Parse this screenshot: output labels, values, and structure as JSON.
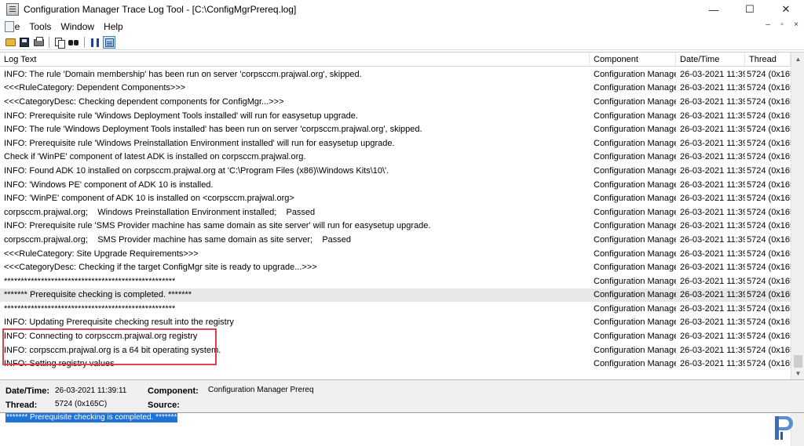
{
  "window": {
    "title": "Configuration Manager Trace Log Tool - [C:\\ConfigMgrPrereq.log]",
    "controls": [
      "—",
      "☐",
      "✕"
    ],
    "mdi_controls": [
      "–",
      "▫",
      "×"
    ]
  },
  "menu": [
    "File",
    "Tools",
    "Window",
    "Help"
  ],
  "toolbar": {
    "buttons": [
      "open-icon",
      "save-icon",
      "print-icon",
      "copy-icon",
      "find-icon",
      "pause-icon",
      "window-icon"
    ]
  },
  "grid": {
    "columns": {
      "log_text": "Log Text",
      "component": "Component",
      "datetime": "Date/Time",
      "thread": "Thread"
    },
    "rows": [
      {
        "text": "INFO: The rule 'Domain membership' has been run on server 'corpsccm.prajwal.org', skipped.",
        "component": "Configuration Manage",
        "datetime": "26-03-2021 11:39",
        "thread": "5724 (0x165"
      },
      {
        "text": "<<<RuleCategory: Dependent Components>>>",
        "component": "Configuration Manage",
        "datetime": "26-03-2021 11:39",
        "thread": "5724 (0x165"
      },
      {
        "text": "<<<CategoryDesc: Checking dependent components for ConfigMgr...>>>",
        "component": "Configuration Manage",
        "datetime": "26-03-2021 11:39",
        "thread": "5724 (0x165"
      },
      {
        "text": "INFO: Prerequisite rule 'Windows Deployment Tools installed' will run for easysetup upgrade.",
        "component": "Configuration Manage",
        "datetime": "26-03-2021 11:39",
        "thread": "5724 (0x165"
      },
      {
        "text": "INFO: The rule 'Windows Deployment Tools installed' has been run on server 'corpsccm.prajwal.org', skipped.",
        "component": "Configuration Manage",
        "datetime": "26-03-2021 11:39",
        "thread": "5724 (0x165"
      },
      {
        "text": "INFO: Prerequisite rule 'Windows Preinstallation Environment installed' will run for easysetup upgrade.",
        "component": "Configuration Manage",
        "datetime": "26-03-2021 11:39",
        "thread": "5724 (0x165"
      },
      {
        "text": "Check if 'WinPE' component of latest ADK is installed on corpsccm.prajwal.org.",
        "component": "Configuration Manage",
        "datetime": "26-03-2021 11:39",
        "thread": "5724 (0x165"
      },
      {
        "text": "INFO: Found ADK 10 installed on corpsccm.prajwal.org at 'C:\\Program Files (x86)\\Windows Kits\\10\\'.",
        "component": "Configuration Manage",
        "datetime": "26-03-2021 11:39",
        "thread": "5724 (0x165"
      },
      {
        "text": "INFO: 'Windows PE' component of ADK 10 is installed.",
        "component": "Configuration Manage",
        "datetime": "26-03-2021 11:39",
        "thread": "5724 (0x165"
      },
      {
        "text": "INFO: 'WinPE' component of ADK 10 is installed on <corpsccm.prajwal.org>",
        "component": "Configuration Manage",
        "datetime": "26-03-2021 11:39",
        "thread": "5724 (0x165"
      },
      {
        "text": "corpsccm.prajwal.org;    Windows Preinstallation Environment installed;    Passed",
        "component": "Configuration Manage",
        "datetime": "26-03-2021 11:39",
        "thread": "5724 (0x165"
      },
      {
        "text": "INFO: Prerequisite rule 'SMS Provider machine has same domain as site server' will run for easysetup upgrade.",
        "component": "Configuration Manage",
        "datetime": "26-03-2021 11:39",
        "thread": "5724 (0x165"
      },
      {
        "text": "corpsccm.prajwal.org;    SMS Provider machine has same domain as site server;    Passed",
        "component": "Configuration Manage",
        "datetime": "26-03-2021 11:39",
        "thread": "5724 (0x165"
      },
      {
        "text": "<<<RuleCategory: Site Upgrade Requirements>>>",
        "component": "Configuration Manage",
        "datetime": "26-03-2021 11:39",
        "thread": "5724 (0x165"
      },
      {
        "text": "<<<CategoryDesc: Checking if the target ConfigMgr site is ready to upgrade...>>>",
        "component": "Configuration Manage",
        "datetime": "26-03-2021 11:39",
        "thread": "5724 (0x165"
      },
      {
        "text": "***************************************************",
        "component": "Configuration Manage",
        "datetime": "26-03-2021 11:39",
        "thread": "5724 (0x165"
      },
      {
        "text": "******* Prerequisite checking is completed. *******",
        "component": "Configuration Manage",
        "datetime": "26-03-2021 11:39",
        "thread": "5724 (0x165",
        "selected": true
      },
      {
        "text": "***************************************************",
        "component": "Configuration Manage",
        "datetime": "26-03-2021 11:39",
        "thread": "5724 (0x165"
      },
      {
        "text": "INFO: Updating Prerequisite checking result into the registry",
        "component": "Configuration Manage",
        "datetime": "26-03-2021 11:39",
        "thread": "5724 (0x165"
      },
      {
        "text": "INFO: Connecting to corpsccm.prajwal.org registry",
        "component": "Configuration Manage",
        "datetime": "26-03-2021 11:39",
        "thread": "5724 (0x165"
      },
      {
        "text": "INFO: corpsccm.prajwal.org is a 64 bit operating system.",
        "component": "Configuration Manage",
        "datetime": "26-03-2021 11:39",
        "thread": "5724 (0x165"
      },
      {
        "text": "INFO: Setting registry values",
        "component": "Configuration Manage",
        "datetime": "26-03-2021 11:39",
        "thread": "5724 (0x165"
      }
    ]
  },
  "details": {
    "datetime_label": "Date/Time:",
    "datetime_value": "26-03-2021 11:39:11",
    "component_label": "Component:",
    "component_value": "Configuration Manager Prereq",
    "thread_label": "Thread:",
    "thread_value": "5724 (0x165C)",
    "source_label": "Source:",
    "source_value": ""
  },
  "message": {
    "selected_text": "******* Prerequisite checking is completed. *******"
  },
  "colors": {
    "highlight_box": "#e0414a",
    "selection": "#1e73d9",
    "logo": "#3a6fb6"
  }
}
